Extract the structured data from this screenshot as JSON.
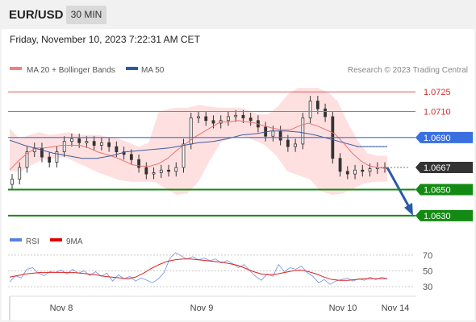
{
  "header": {
    "symbol": "EUR/USD",
    "timeframe": "30 MIN",
    "timestamp": "Friday, November 10, 2023 7:22:31 AM CET"
  },
  "colors": {
    "bollinger_band": "#ffd6d6",
    "ma20": "#e57373",
    "ma50": "#3f5fa0",
    "candle": "#333333",
    "resistance": "#e06060",
    "pivot": "#3a6fe0",
    "support": "#138a13",
    "current_price": "#333333",
    "rsi": "#6f8fe0",
    "rsi_ma": "#e02020",
    "arrow": "#2a5aa8"
  },
  "chart_data": [
    {
      "type": "line",
      "title": "",
      "legend": [
        {
          "name": "MA 20 + Bollinger Bands",
          "color": "#f08080"
        },
        {
          "name": "MA 50",
          "color": "#2c5aa0"
        }
      ],
      "source": "Research © 2023 Trading Central",
      "x_labels": [
        "Nov 8",
        "Nov 9",
        "Nov 10",
        "Nov 14"
      ],
      "ylim": [
        1.0625,
        1.0735
      ],
      "price": [
        1.0658,
        1.0667,
        1.0679,
        1.0682,
        1.0675,
        1.0671,
        1.0679,
        1.0687,
        1.0689,
        1.0686,
        1.0687,
        1.0684,
        1.0686,
        1.0683,
        1.0679,
        1.0677,
        1.0673,
        1.0667,
        1.0662,
        1.0663,
        1.0665,
        1.0664,
        1.0667,
        1.0685,
        1.0705,
        1.0706,
        1.0703,
        1.0701,
        1.0703,
        1.0706,
        1.0707,
        1.0705,
        1.0703,
        1.0698,
        1.0691,
        1.0695,
        1.0688,
        1.0683,
        1.0685,
        1.0705,
        1.0718,
        1.0712,
        1.0706,
        1.0674,
        1.0664,
        1.0662,
        1.0665,
        1.0664,
        1.0666,
        1.0667,
        1.0667
      ],
      "ma20": [
        1.0665,
        1.0672,
        1.0678,
        1.0682,
        1.0682,
        1.0683,
        1.0684,
        1.0684,
        1.0684,
        1.0682,
        1.0679,
        1.0677,
        1.0675,
        1.0672,
        1.0669,
        1.0668,
        1.0668,
        1.067,
        1.0674,
        1.068,
        1.0685,
        1.069,
        1.0694,
        1.0698,
        1.0702,
        1.0702,
        1.0703,
        1.0702,
        1.0701,
        1.0699,
        1.0697,
        1.0696,
        1.0696,
        1.0699,
        1.0701,
        1.0699,
        1.0696,
        1.0693,
        1.0686,
        1.0678,
        1.0672,
        1.0668,
        1.0667,
        1.0666
      ],
      "bb_upper": [
        1.0697,
        1.0689,
        1.0692,
        1.0694,
        1.0692,
        1.0693,
        1.0694,
        1.0692,
        1.0692,
        1.0692,
        1.069,
        1.0689,
        1.0686,
        1.0683,
        1.0686,
        1.071,
        1.0712,
        1.0713,
        1.0713,
        1.0715,
        1.0714,
        1.0713,
        1.0713,
        1.0713,
        1.0711,
        1.0708,
        1.0708,
        1.0714,
        1.0723,
        1.0728,
        1.0728,
        1.0728,
        1.0725,
        1.0718,
        1.0702,
        1.0688,
        1.0678,
        1.0676,
        1.0676
      ],
      "bb_lower": [
        1.0664,
        1.0664,
        1.0669,
        1.0673,
        1.0674,
        1.0675,
        1.0671,
        1.0667,
        1.0663,
        1.066,
        1.0657,
        1.0656,
        1.0656,
        1.0656,
        1.0651,
        1.0646,
        1.0647,
        1.0656,
        1.0672,
        1.0686,
        1.069,
        1.0691,
        1.0688,
        1.0684,
        1.0676,
        1.0664,
        1.0661,
        1.0658,
        1.0649,
        1.0646,
        1.0647,
        1.0651,
        1.0655,
        1.0656,
        1.0656
      ],
      "ma50": [
        1.0688,
        1.0684,
        1.0681,
        1.0678,
        1.0676,
        1.0674,
        1.0674,
        1.0676,
        1.0679,
        1.068,
        1.0681,
        1.0682,
        1.0684,
        1.0686,
        1.0687,
        1.0689,
        1.0692,
        1.0693,
        1.0695,
        1.0695,
        1.0694,
        1.0692,
        1.0689,
        1.0686,
        1.0683,
        1.0683,
        1.0683
      ],
      "levels": [
        {
          "label": "1.0725",
          "value": 1.0725,
          "kind": "resistance"
        },
        {
          "label": "1.0710",
          "value": 1.071,
          "kind": "resistance"
        },
        {
          "label": "1.0690",
          "value": 1.069,
          "kind": "pivot"
        },
        {
          "label": "1.0667",
          "value": 1.0667,
          "kind": "current"
        },
        {
          "label": "1.0650",
          "value": 1.065,
          "kind": "support"
        },
        {
          "label": "1.0630",
          "value": 1.063,
          "kind": "support"
        }
      ],
      "forecast_arrow": {
        "from": 1.0667,
        "to": 1.063
      }
    },
    {
      "type": "line",
      "title": "",
      "legend": [
        {
          "name": "RSI",
          "color": "#5b7fe0"
        },
        {
          "name": "9MA",
          "color": "#e00000"
        }
      ],
      "y_ticks": [
        70,
        50,
        30
      ],
      "ylim": [
        25,
        78
      ],
      "rsi": [
        36,
        44,
        41,
        52,
        54,
        47,
        44,
        49,
        48,
        51,
        46,
        52,
        47,
        50,
        44,
        49,
        43,
        47,
        37,
        45,
        40,
        43,
        37,
        41,
        38,
        35,
        40,
        48,
        66,
        73,
        69,
        65,
        68,
        64,
        66,
        63,
        65,
        60,
        63,
        59,
        54,
        58,
        50,
        43,
        38,
        46,
        43,
        58,
        49,
        54,
        52,
        56,
        48,
        43,
        35,
        39,
        33,
        37,
        39,
        41,
        37,
        40,
        38,
        42,
        39,
        42,
        40
      ],
      "rsi_ma": [
        42,
        44,
        46,
        47,
        48,
        48,
        48,
        48,
        48,
        47,
        46,
        45,
        43,
        42,
        41,
        40,
        42,
        47,
        53,
        58,
        62,
        64,
        65,
        65,
        64,
        63,
        62,
        61,
        59,
        57,
        53,
        49,
        46,
        45,
        46,
        48,
        50,
        51,
        49,
        46,
        42,
        39,
        38,
        38,
        39,
        40,
        40,
        40,
        40
      ]
    }
  ]
}
